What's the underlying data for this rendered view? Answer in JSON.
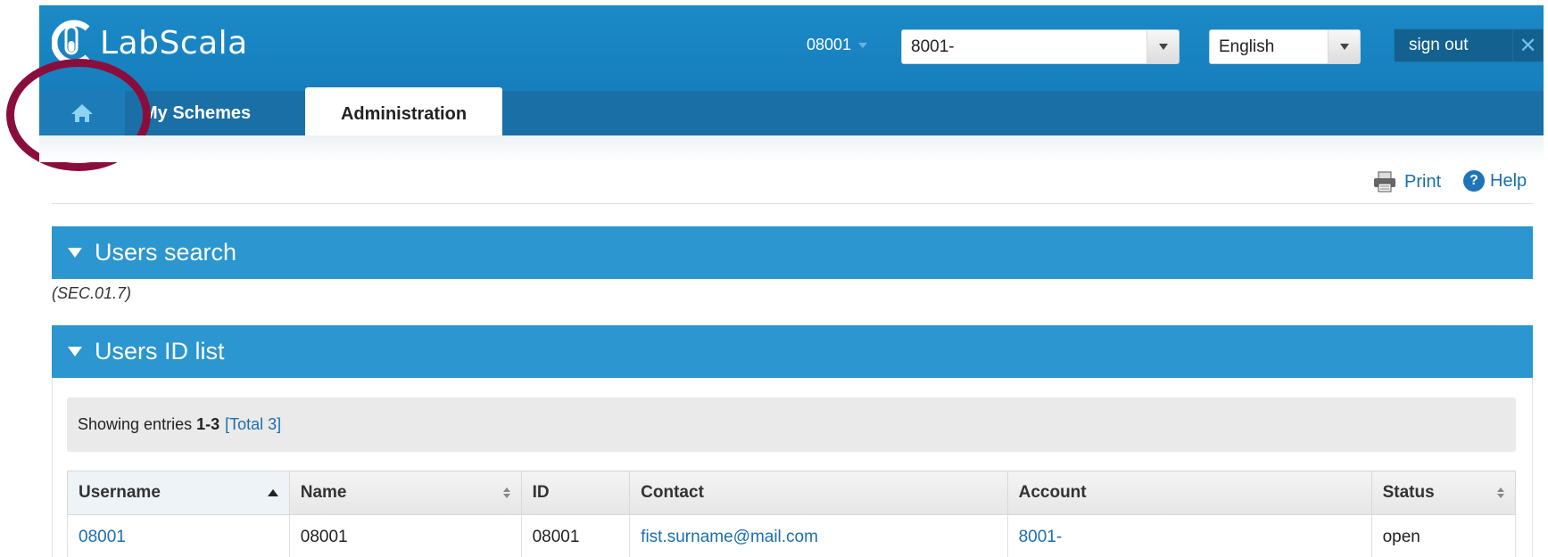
{
  "app": {
    "title": "LabScala"
  },
  "header": {
    "user_code": "08001",
    "account_select": "8001-",
    "language_select": "English",
    "signout_label": "sign out",
    "signout_close": "✕"
  },
  "tabs": [
    {
      "label": "",
      "icon": "home-icon"
    },
    {
      "label": "My Schemes"
    },
    {
      "label": "Administration"
    }
  ],
  "toolbar": {
    "print_label": "Print",
    "help_label": "Help",
    "help_glyph": "?"
  },
  "users_search": {
    "title": "Users search",
    "code": "(SEC.01.7)"
  },
  "users_list": {
    "title": "Users ID list",
    "info_prefix": "Showing entries",
    "info_range": "1-3",
    "info_total": "[Total 3]",
    "columns": [
      "Username",
      "Name",
      "ID",
      "Contact",
      "Account",
      "Status"
    ],
    "rows": [
      {
        "username": "08001",
        "name": "08001",
        "id": "08001",
        "contact": "fist.surname@mail.com",
        "account": "8001-",
        "status": "open"
      }
    ]
  },
  "colors": {
    "header_blue": "#1b8ac6",
    "panel_blue": "#2b96cf",
    "link": "#1a6fae",
    "annotation_ring": "#8a0e3c"
  }
}
